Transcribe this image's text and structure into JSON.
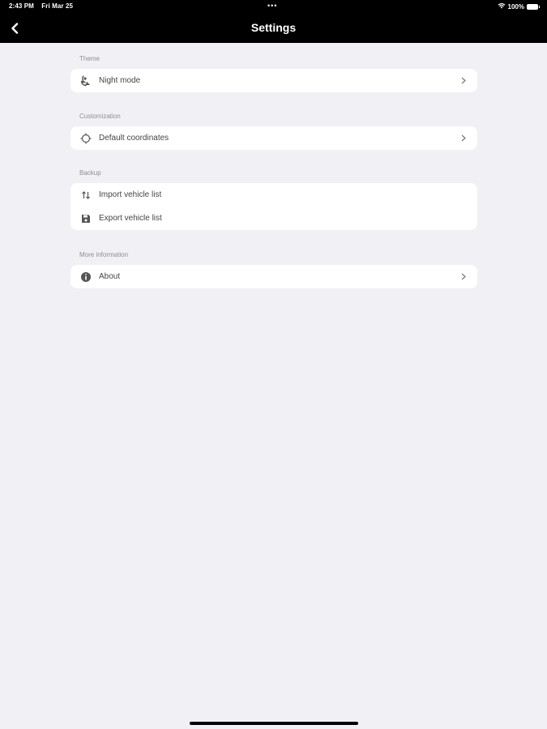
{
  "status_bar": {
    "time": "2:43 PM",
    "date": "Fri Mar 25",
    "dots": "•••",
    "battery_text": "100%"
  },
  "nav": {
    "title": "Settings",
    "back_icon": "chevron-left-icon"
  },
  "sections": [
    {
      "header": "Theme",
      "items": [
        {
          "label": "Night mode",
          "icon": "night-mode-icon",
          "has_chevron": true
        }
      ]
    },
    {
      "header": "Customization",
      "items": [
        {
          "label": "Default coordinates",
          "icon": "crosshair-icon",
          "has_chevron": true
        }
      ]
    },
    {
      "header": "Backup",
      "items": [
        {
          "label": "Import vehicle list",
          "icon": "import-arrows-icon",
          "has_chevron": false
        },
        {
          "label": "Export vehicle list",
          "icon": "floppy-disk-icon",
          "has_chevron": false
        }
      ]
    },
    {
      "header": "More information",
      "items": [
        {
          "label": "About",
          "icon": "info-icon",
          "has_chevron": true
        }
      ]
    }
  ],
  "colors": {
    "topbar": "#000000",
    "background": "#f1f0f5",
    "card": "#ffffff",
    "section_label": "#8e8e93"
  }
}
